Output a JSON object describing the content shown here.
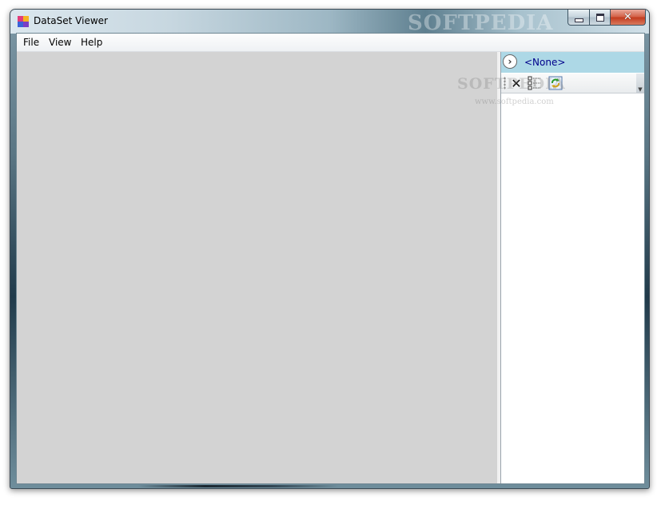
{
  "window": {
    "title": "DataSet Viewer",
    "watermark": "SOFTPEDIA"
  },
  "caption_buttons": {
    "close_glyph": "✕"
  },
  "menu": {
    "items": [
      {
        "label": "File"
      },
      {
        "label": "View"
      },
      {
        "label": "Help"
      }
    ]
  },
  "panel": {
    "nav_glyph": "›",
    "selected_label": "<None>",
    "toolbar": {
      "delete_glyph": "✕",
      "overflow_glyph": "▼"
    }
  },
  "watermark_overlay": {
    "brand": "SOFTPEDIA",
    "url": "www.softpedia.com"
  },
  "colors": {
    "main_area": "#d3d3d3",
    "panel_header": "#add8e6",
    "selected_label": "#00008b",
    "close_button": "#c23b1e"
  },
  "icons": {
    "app": "dataset-app-icon",
    "delete": "delete-x-icon",
    "tree": "tree-view-icon",
    "refresh": "refresh-icon",
    "nav": "chevron-right-circle-icon"
  }
}
